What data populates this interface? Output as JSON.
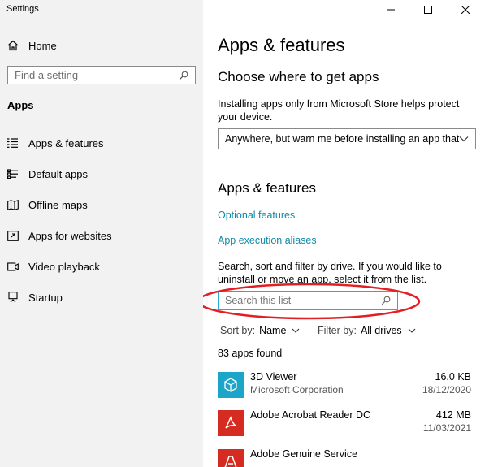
{
  "window": {
    "title": "Settings"
  },
  "sidebar": {
    "home_label": "Home",
    "search_placeholder": "Find a setting",
    "section_label": "Apps",
    "items": [
      {
        "label": "Apps & features",
        "icon": "list-icon"
      },
      {
        "label": "Default apps",
        "icon": "default-apps-icon"
      },
      {
        "label": "Offline maps",
        "icon": "map-icon"
      },
      {
        "label": "Apps for websites",
        "icon": "link-window-icon"
      },
      {
        "label": "Video playback",
        "icon": "video-icon"
      },
      {
        "label": "Startup",
        "icon": "startup-icon"
      }
    ]
  },
  "main": {
    "title": "Apps & features",
    "choose_heading": "Choose where to get apps",
    "choose_description": "Installing apps only from Microsoft Store helps protect your device.",
    "dropdown_value": "Anywhere, but warn me before installing an app that...",
    "apps_heading": "Apps & features",
    "links": {
      "optional_features": "Optional features",
      "execution_aliases": "App execution aliases"
    },
    "search_description": "Search, sort and filter by drive. If you would like to uninstall or move an app, select it from the list.",
    "list_search_placeholder": "Search this list",
    "sort_label": "Sort by:",
    "sort_value": "Name",
    "filter_label": "Filter by:",
    "filter_value": "All drives",
    "apps_count": "83 apps found",
    "apps": [
      {
        "name": "3D Viewer",
        "publisher": "Microsoft Corporation",
        "size": "16.0 KB",
        "date": "18/12/2020",
        "icon": "cube-icon",
        "icon_color": "#1aa5c9"
      },
      {
        "name": "Adobe Acrobat Reader DC",
        "publisher": "",
        "size": "412 MB",
        "date": "11/03/2021",
        "icon": "acrobat-icon",
        "icon_color": "#d62b21"
      },
      {
        "name": "Adobe Genuine Service",
        "publisher": "",
        "size": "",
        "date": "",
        "icon": "adobe-icon",
        "icon_color": "#d62b21"
      }
    ]
  },
  "colors": {
    "accent_link": "#0f8aa8",
    "annotation": "#e41e25",
    "search_focus": "#2aa9d3"
  }
}
